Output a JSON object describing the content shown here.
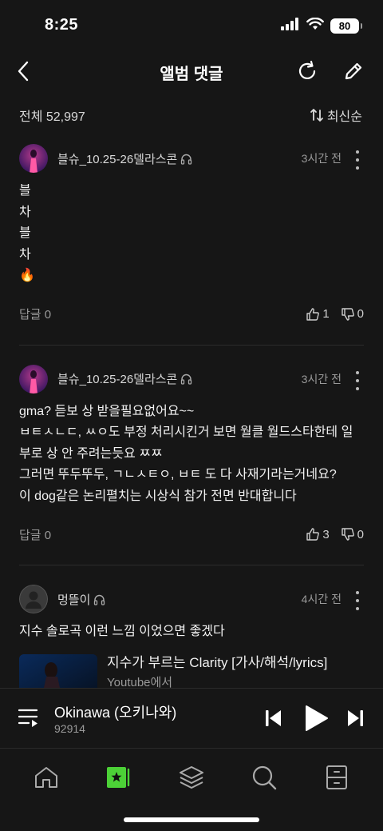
{
  "status_bar": {
    "time": "8:25",
    "battery": "80"
  },
  "header": {
    "title": "앨범 댓글"
  },
  "summary": {
    "total_label": "전체 52,997",
    "sort_label": "최신순"
  },
  "comments": [
    {
      "username": "블슈_10.25-26델라스콘",
      "time": "3시간 전",
      "lines": [
        "블",
        "차",
        "블",
        "차",
        "🔥"
      ],
      "reply_label": "답글 0",
      "likes": "1",
      "dislikes": "0"
    },
    {
      "username": "블슈_10.25-26델라스콘",
      "time": "3시간 전",
      "lines": [
        "gma? 듣보 상 받을필요없어요~~",
        "ㅂㅌㅅㄴㄷ, ㅆㅇ도 부정 처리시킨거 보면 월클 월드스타한테 일",
        "부로 상 안 주려는듯요 ㅉㅉ",
        "그러면  뚜두뚜두, ㄱㄴㅅㅌㅇ, ㅂㅌ 도 다 사재기라는거네요?",
        "이 dog같은 논리펼치는 시상식 참가 전면 반대합니다"
      ],
      "reply_label": "답글 0",
      "likes": "3",
      "dislikes": "0"
    },
    {
      "username": "멍뜰이",
      "time": "4시간 전",
      "lines": [
        "지수 솔로곡 이런 느낌 이었으면 좋겠다"
      ],
      "video": {
        "title": "지수가 부르는 Clarity [가사/해석/lyrics]",
        "source": "Youtube에서"
      }
    }
  ],
  "player": {
    "track_title": "Okinawa (오키나와)",
    "track_sub": "92914"
  },
  "colors": {
    "background": "#161616",
    "accent_green": "#4cd137",
    "text_secondary": "#9a9a9a"
  }
}
